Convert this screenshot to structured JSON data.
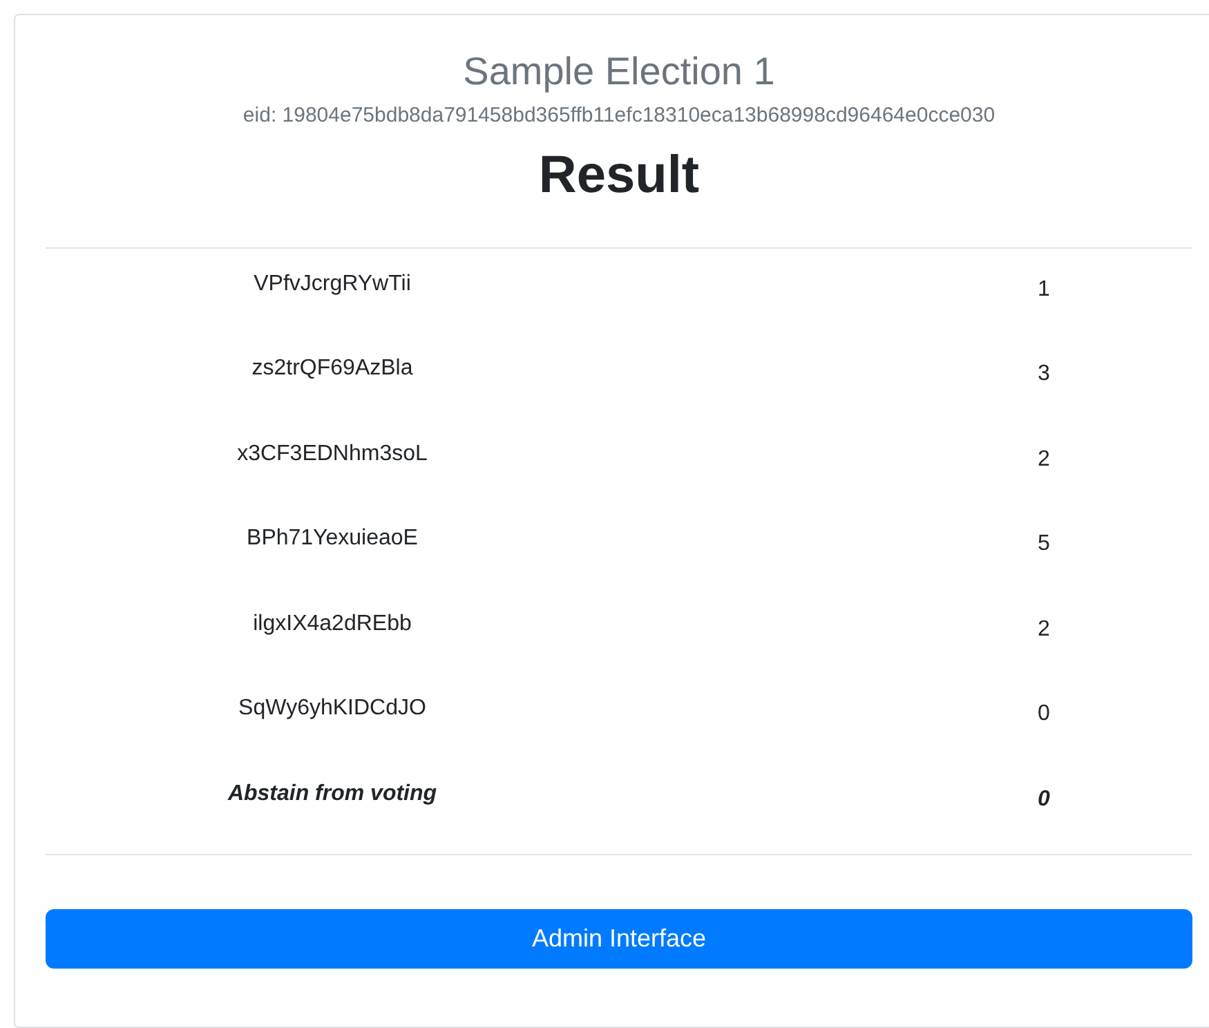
{
  "election": {
    "title": "Sample Election 1",
    "eid": "eid: 19804e75bdb8da791458bd365ffb11efc18310eca13b68998cd96464e0cce030"
  },
  "heading": "Result",
  "results": [
    {
      "kind": "candidate",
      "name": "VPfvJcrgRYwTii",
      "votes": "1"
    },
    {
      "kind": "candidate",
      "name": "zs2trQF69AzBla",
      "votes": "3"
    },
    {
      "kind": "candidate",
      "name": "x3CF3EDNhm3soL",
      "votes": "2"
    },
    {
      "kind": "candidate",
      "name": "BPh71YexuieaoE",
      "votes": "5"
    },
    {
      "kind": "candidate",
      "name": "ilgxIX4a2dREbb",
      "votes": "2"
    },
    {
      "kind": "candidate",
      "name": "SqWy6yhKIDCdJO",
      "votes": "0"
    },
    {
      "kind": "abstain",
      "name": "Abstain from voting",
      "votes": "0"
    }
  ],
  "button": "Admin Interface"
}
